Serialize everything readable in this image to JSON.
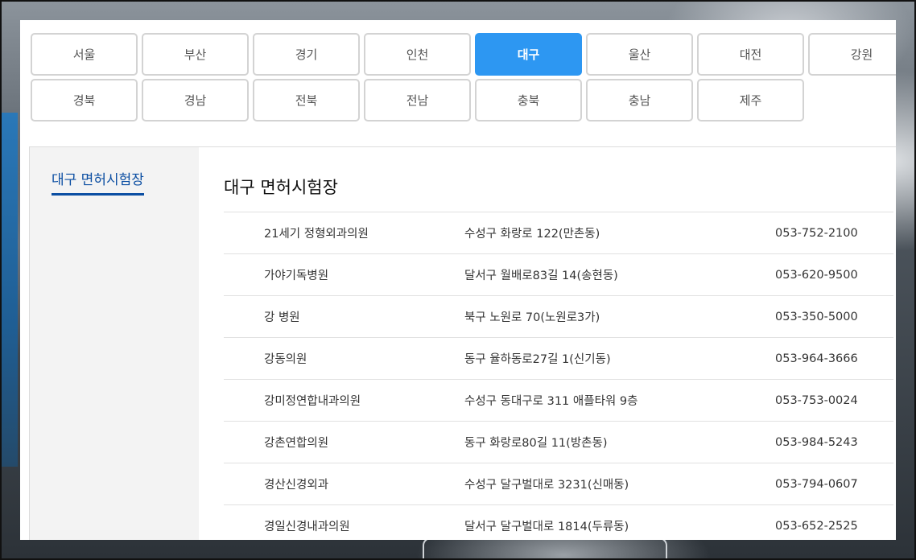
{
  "regions": {
    "row1": [
      "서울",
      "부산",
      "경기",
      "인천",
      "대구",
      "울산",
      "대전",
      "강원"
    ],
    "row2": [
      "경북",
      "경남",
      "전북",
      "전남",
      "충북",
      "충남",
      "제주"
    ],
    "active": "대구"
  },
  "sidebar": {
    "active_label": "대구 면허시험장"
  },
  "main": {
    "title": "대구 면허시험장",
    "hospitals": [
      {
        "name": "21세기 정형외과의원",
        "address": "수성구 화랑로 122(만촌동)",
        "phone": "053-752-2100"
      },
      {
        "name": "가야기독병원",
        "address": "달서구 월배로83길 14(송현동)",
        "phone": "053-620-9500"
      },
      {
        "name": "강 병원",
        "address": "북구 노원로 70(노원로3가)",
        "phone": "053-350-5000"
      },
      {
        "name": "강동의원",
        "address": "동구 율하동로27길 1(신기동)",
        "phone": "053-964-3666"
      },
      {
        "name": "강미정연합내과의원",
        "address": "수성구 동대구로 311 애플타워 9층",
        "phone": "053-753-0024"
      },
      {
        "name": "강촌연합의원",
        "address": "동구 화랑로80길 11(방촌동)",
        "phone": "053-984-5243"
      },
      {
        "name": "경산신경외과",
        "address": "수성구 달구벌대로 3231(신매동)",
        "phone": "053-794-0607"
      },
      {
        "name": "경일신경내과의원",
        "address": "달서구 달구벌대로 1814(두류동)",
        "phone": "053-652-2525"
      }
    ]
  },
  "colors": {
    "accent": "#2d97f2",
    "sidebar_link": "#0b4ea2"
  }
}
